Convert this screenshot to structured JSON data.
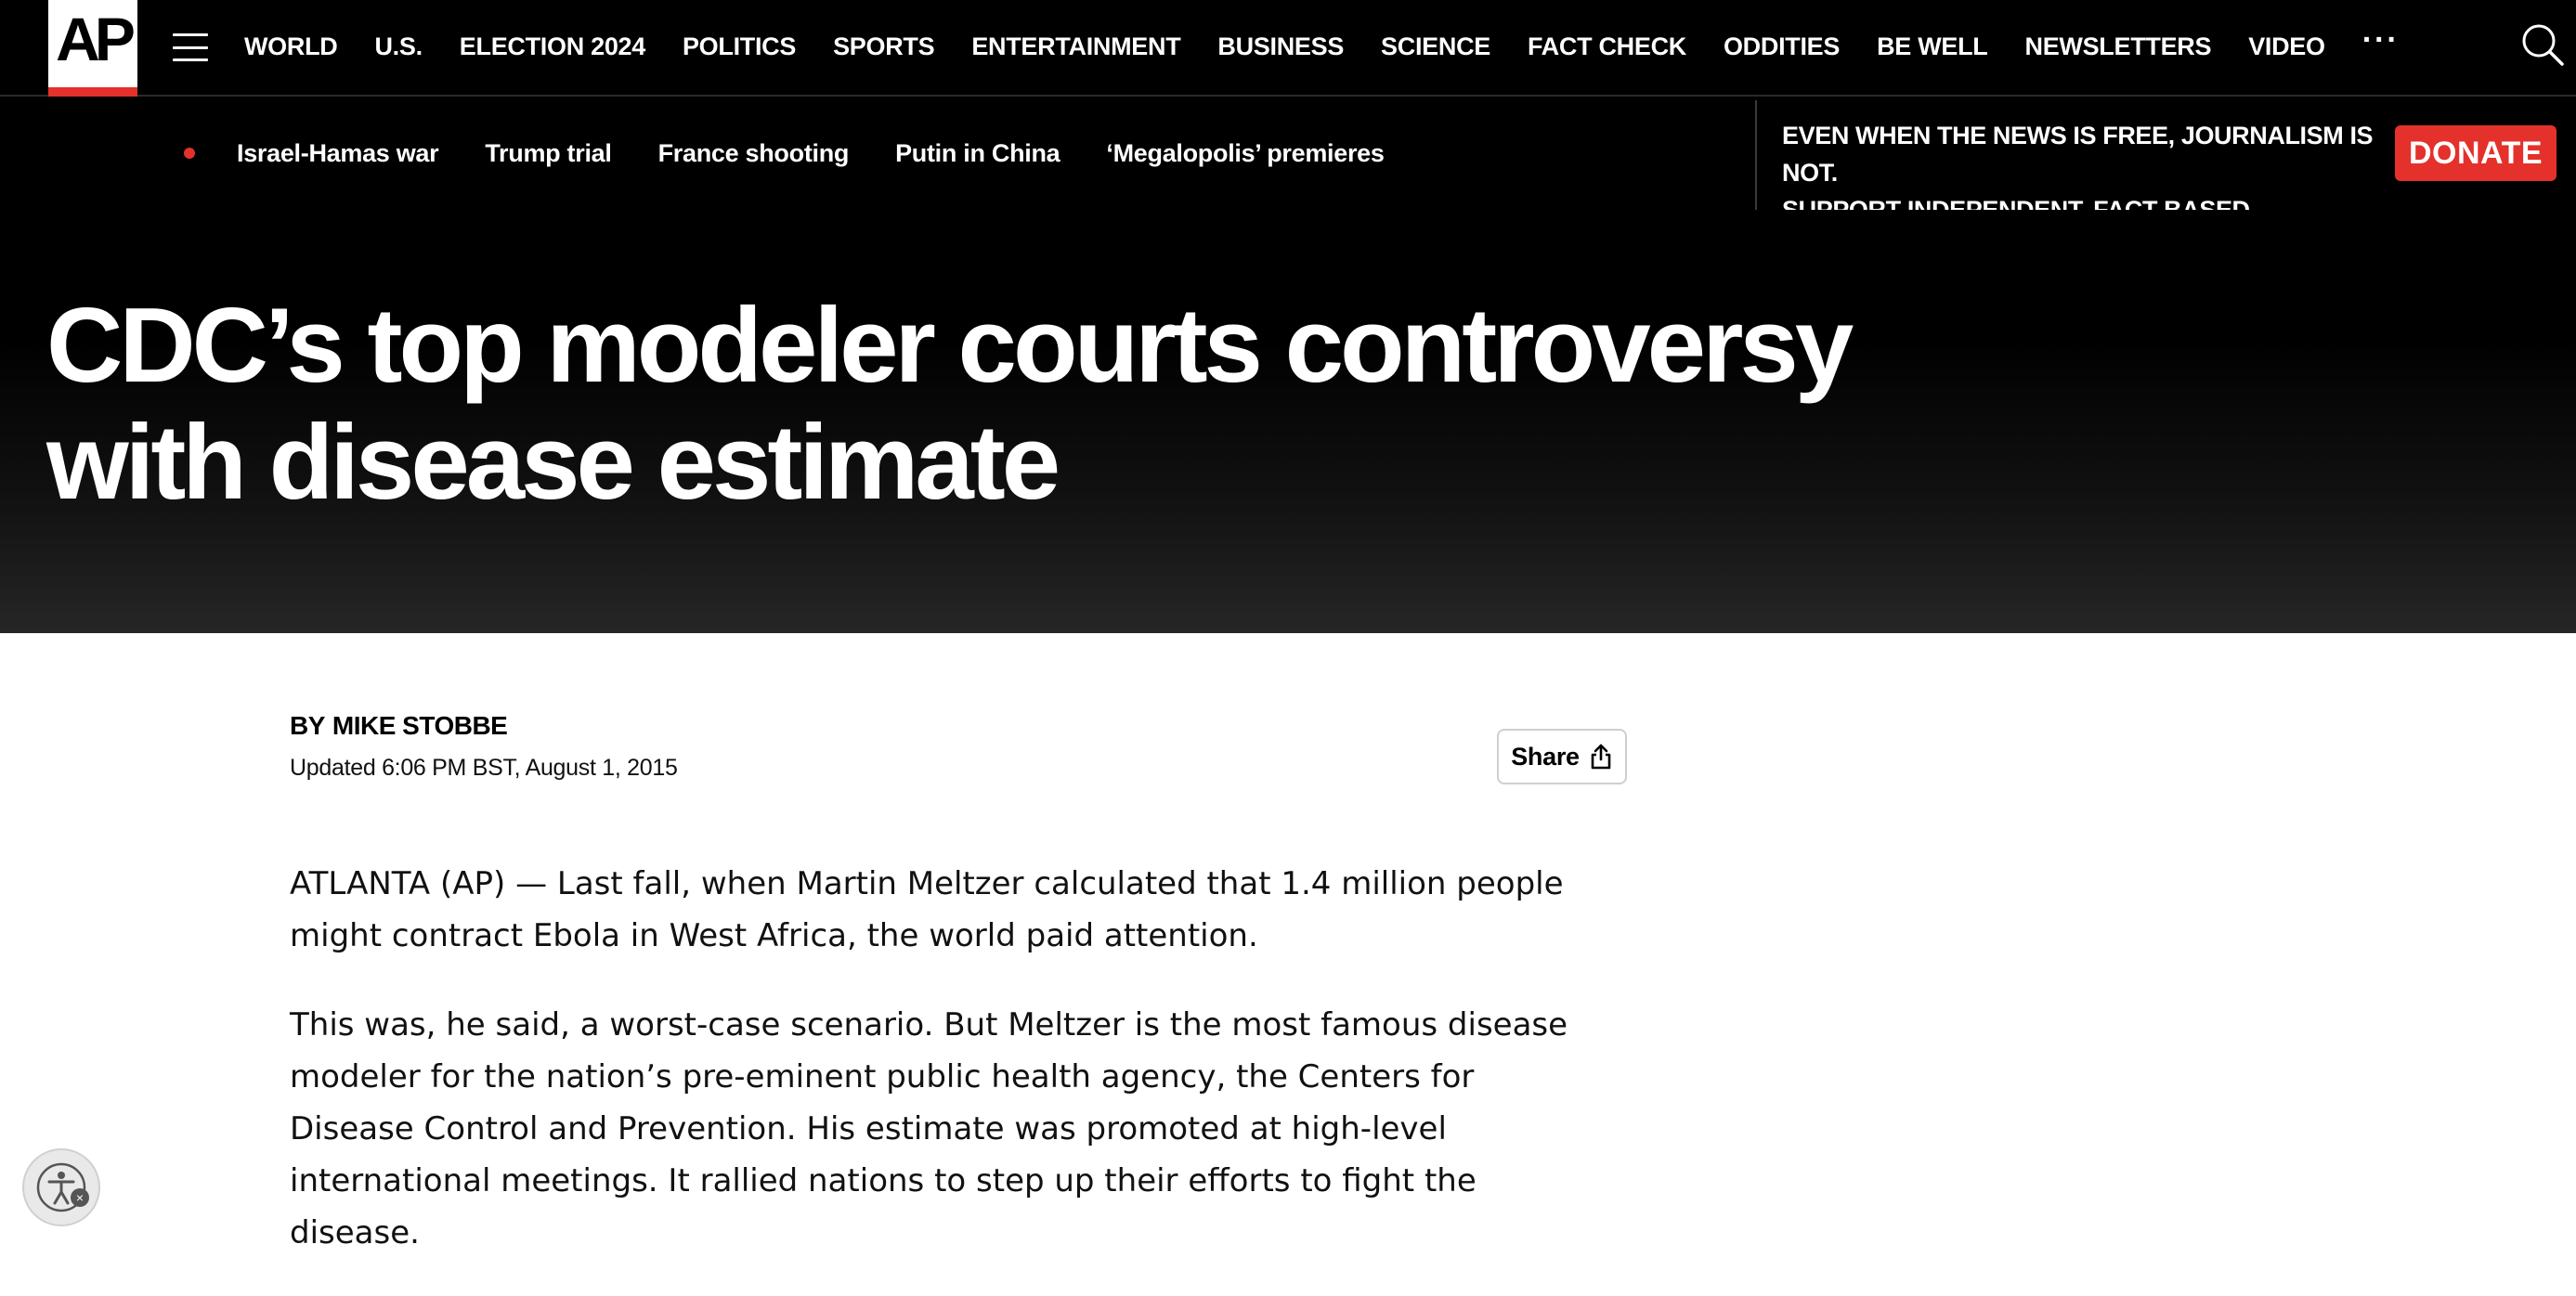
{
  "brand": {
    "logo_text": "AP",
    "accent_color": "#e4312b"
  },
  "nav": {
    "menu_icon": "hamburger-menu-icon",
    "items": [
      {
        "label": "WORLD"
      },
      {
        "label": "U.S."
      },
      {
        "label": "ELECTION 2024"
      },
      {
        "label": "POLITICS"
      },
      {
        "label": "SPORTS"
      },
      {
        "label": "ENTERTAINMENT"
      },
      {
        "label": "BUSINESS"
      },
      {
        "label": "SCIENCE"
      },
      {
        "label": "FACT CHECK"
      },
      {
        "label": "ODDITIES"
      },
      {
        "label": "BE WELL"
      },
      {
        "label": "NEWSLETTERS"
      },
      {
        "label": "VIDEO"
      }
    ],
    "more_label": "···",
    "search_icon": "search-icon"
  },
  "trending": {
    "items": [
      {
        "label": "Israel-Hamas war"
      },
      {
        "label": "Trump trial"
      },
      {
        "label": "France shooting"
      },
      {
        "label": "Putin in China"
      },
      {
        "label": "‘Megalopolis’ premieres"
      }
    ]
  },
  "donate": {
    "line1": "EVEN WHEN THE NEWS IS FREE, JOURNALISM IS NOT.",
    "line2": "SUPPORT INDEPENDENT, FACT-BASED JOURNALISM.",
    "button_label": "DONATE"
  },
  "article": {
    "headline_line1": "CDC’s top modeler courts controversy",
    "headline_line2": "with disease estimate",
    "byline_prefix": "BY",
    "author": "MIKE STOBBE",
    "updated": "Updated 6:06 PM BST, August 1, 2015",
    "share_label": "Share",
    "paragraphs": [
      "ATLANTA (AP) — Last fall, when Martin Meltzer calculated that 1.4 million people might contract Ebola in West Africa, the world paid attention.",
      "This was, he said, a worst-case scenario. But Meltzer is the most famous disease modeler for the nation’s pre-eminent public health agency, the Centers for Disease Control and Prevention. His estimate was promoted at high-level international meetings. It rallied nations to step up their efforts to fight the disease."
    ]
  }
}
